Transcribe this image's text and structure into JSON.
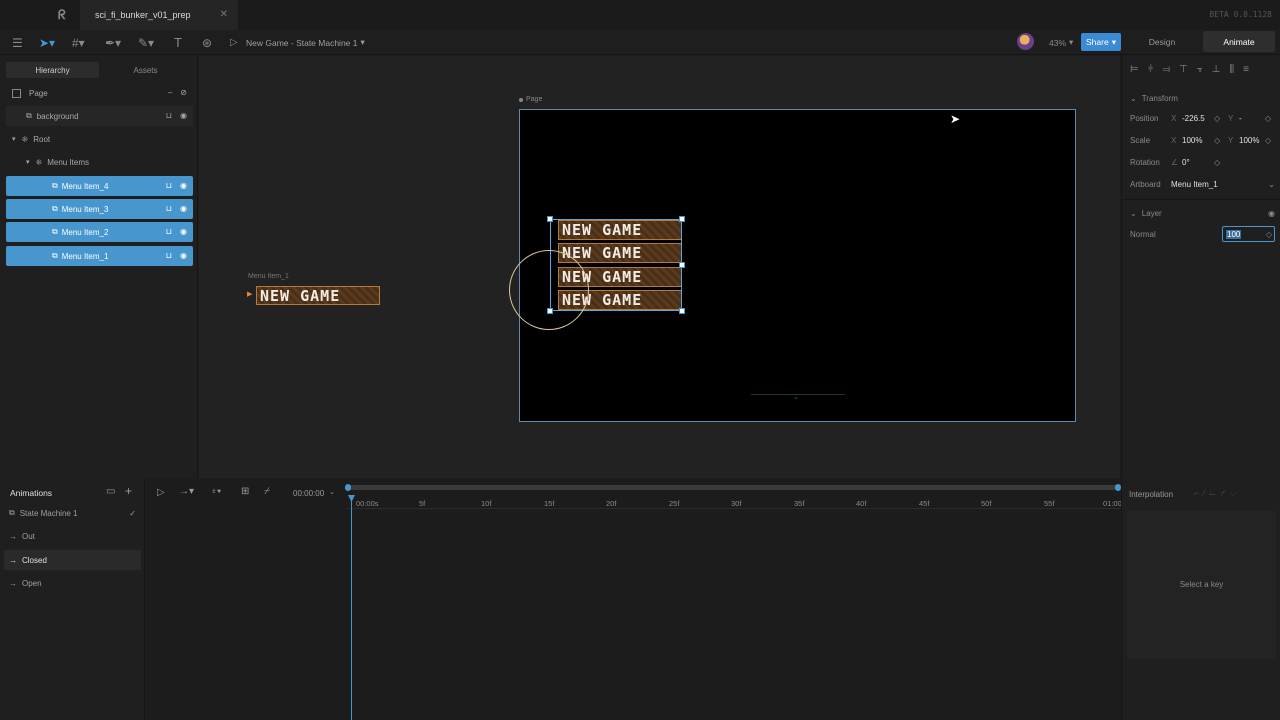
{
  "tab": {
    "title": "sci_fi_bunker_v01_prep",
    "version": "BETA 0.8.1128"
  },
  "toolbar": {
    "state_machine": "New Game - State Machine 1",
    "zoom": "43%",
    "share": "Share",
    "mode_design": "Design",
    "mode_animate": "Animate"
  },
  "hierarchy": {
    "tabs": [
      "Hierarchy",
      "Assets"
    ],
    "items": [
      {
        "label": "Page",
        "selected": false
      },
      {
        "label": "background",
        "selected": false
      },
      {
        "label": "Root",
        "selected": false
      },
      {
        "label": "Menu Items",
        "selected": false
      },
      {
        "label": "Menu Item_4",
        "selected": true
      },
      {
        "label": "Menu Item_3",
        "selected": true
      },
      {
        "label": "Menu Item_2",
        "selected": true
      },
      {
        "label": "Menu Item_1",
        "selected": true
      }
    ]
  },
  "canvas": {
    "artboard_label": "Page",
    "component_label": "Menu Item_1",
    "button_text": "NEW GAME"
  },
  "properties": {
    "transform_title": "Transform",
    "position_label": "Position",
    "pos_x_label": "X",
    "pos_x": "-226.5",
    "pos_y_label": "Y",
    "pos_y": "-",
    "scale_label": "Scale",
    "scale_x_label": "X",
    "scale_x": "100%",
    "scale_y_label": "Y",
    "scale_y": "100%",
    "rotation_label": "Rotation",
    "rotation": "0°",
    "artboard_label": "Artboard",
    "artboard_value": "Menu Item_1",
    "layer_title": "Layer",
    "blend": "Normal",
    "opacity": "100"
  },
  "animations": {
    "title": "Animations",
    "items": [
      {
        "label": "State Machine 1",
        "selected": false
      },
      {
        "label": "Out",
        "selected": false
      },
      {
        "label": "Closed",
        "selected": true
      },
      {
        "label": "Open",
        "selected": false
      }
    ]
  },
  "timeline": {
    "time": "00:00:00",
    "ticks": [
      "00:00s",
      "5f",
      "10f",
      "15f",
      "20f",
      "25f",
      "30f",
      "35f",
      "40f",
      "45f",
      "50f",
      "55f",
      "01:00"
    ]
  },
  "interpolation": {
    "title": "Interpolation",
    "empty": "Select a key"
  },
  "colors": {
    "accent": "#4796cd",
    "share": "#3a8ad6",
    "button_border": "#b27a3e"
  }
}
